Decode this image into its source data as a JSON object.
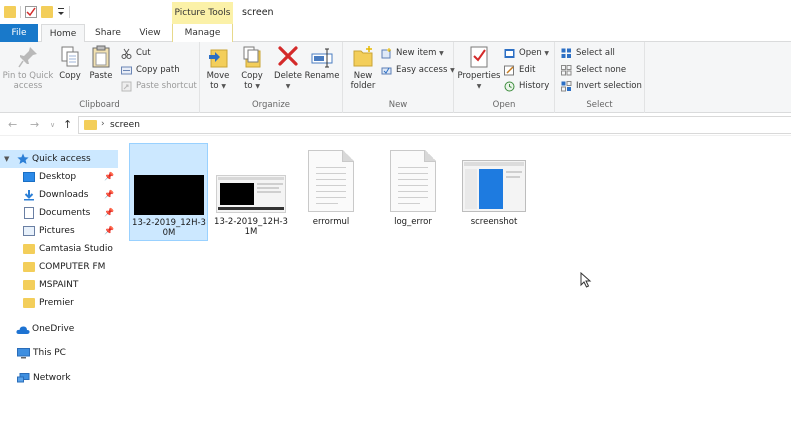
{
  "titlebar": {
    "context_tab": "Picture Tools",
    "window_title": "screen"
  },
  "tabs": {
    "file": "File",
    "home": "Home",
    "share": "Share",
    "view": "View",
    "manage": "Manage"
  },
  "ribbon": {
    "clipboard": {
      "label": "Clipboard",
      "pin_line1": "Pin to Quick",
      "pin_line2": "access",
      "copy": "Copy",
      "paste": "Paste",
      "cut": "Cut",
      "copy_path": "Copy path",
      "paste_shortcut": "Paste shortcut"
    },
    "organize": {
      "label": "Organize",
      "move_to_line1": "Move",
      "move_to_line2": "to",
      "copy_to_line1": "Copy",
      "copy_to_line2": "to",
      "delete": "Delete",
      "rename": "Rename"
    },
    "new": {
      "label": "New",
      "new_folder_line1": "New",
      "new_folder_line2": "folder",
      "new_item": "New item",
      "easy_access": "Easy access"
    },
    "open": {
      "label": "Open",
      "properties": "Properties",
      "open": "Open",
      "edit": "Edit",
      "history": "History"
    },
    "select": {
      "label": "Select",
      "select_all": "Select all",
      "select_none": "Select none",
      "invert_selection": "Invert selection"
    }
  },
  "address": {
    "path": "screen"
  },
  "navpane": {
    "quick_access": "Quick access",
    "items": [
      {
        "label": "Desktop",
        "pinned": "📌"
      },
      {
        "label": "Downloads",
        "pinned": "📌"
      },
      {
        "label": "Documents",
        "pinned": "📌"
      },
      {
        "label": "Pictures",
        "pinned": "📌"
      },
      {
        "label": "Camtasia Studio",
        "pinned": ""
      },
      {
        "label": "COMPUTER FM",
        "pinned": ""
      },
      {
        "label": "MSPAINT",
        "pinned": ""
      },
      {
        "label": "Premier",
        "pinned": ""
      }
    ],
    "onedrive": "OneDrive",
    "this_pc": "This PC",
    "network": "Network"
  },
  "files": [
    {
      "name": "13-2-2019_12H-30M",
      "kind": "video",
      "selected": true
    },
    {
      "name": "13-2-2019_12H-31M",
      "kind": "video",
      "selected": false
    },
    {
      "name": "errormul",
      "kind": "document",
      "selected": false
    },
    {
      "name": "log_error",
      "kind": "document",
      "selected": false
    },
    {
      "name": "screenshot",
      "kind": "image",
      "selected": false
    }
  ],
  "colors": {
    "accent": "#1979ca",
    "selection": "#cce8ff",
    "folder": "#f3ce5a",
    "context_tab": "#fbf1a8",
    "delete_red": "#d42a2a"
  }
}
